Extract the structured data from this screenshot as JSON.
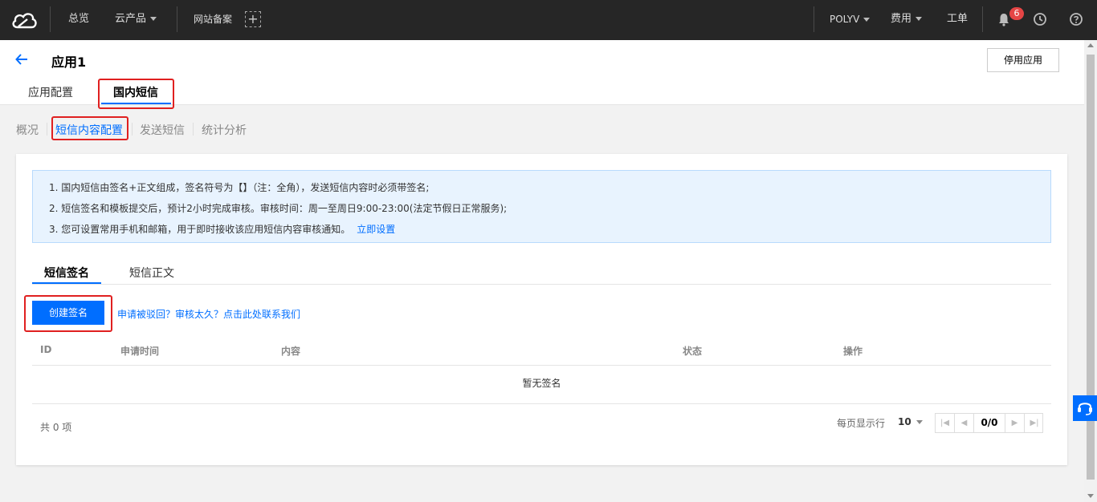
{
  "topnav": {
    "overview": "总览",
    "products": "云产品",
    "icp": "网站备案",
    "plus": "+",
    "account": "POLYV",
    "billing": "费用",
    "ticket": "工单",
    "notification_count": "6"
  },
  "header": {
    "title": "应用1",
    "disable_button": "停用应用",
    "tabs": [
      {
        "label": "应用配置"
      },
      {
        "label": "国内短信"
      }
    ]
  },
  "subnav": {
    "items": [
      {
        "label": "概况"
      },
      {
        "label": "短信内容配置"
      },
      {
        "label": "发送短信"
      },
      {
        "label": "统计分析"
      }
    ]
  },
  "notice": {
    "line1": "1. 国内短信由签名+正文组成，签名符号为【】（注：全角），发送短信内容时必须带签名;",
    "line2": "2. 短信签名和模板提交后，预计2小时完成审核。审核时间：周一至周日9:00-23:00(法定节假日正常服务);",
    "line3": "3. 您可设置常用手机和邮箱，用于即时接收该应用短信内容审核通知。",
    "line3_link": "立即设置"
  },
  "inner_tabs": [
    {
      "label": "短信签名"
    },
    {
      "label": "短信正文"
    }
  ],
  "actions": {
    "create_button": "创建签名",
    "help_link": "申请被驳回？审核太久？点击此处联系我们"
  },
  "table": {
    "columns": [
      "ID",
      "申请时间",
      "内容",
      "状态",
      "操作"
    ],
    "empty_text": "暂无签名"
  },
  "pagination": {
    "total": "共 0 项",
    "per_page_label": "每页显示行",
    "page_size": "10",
    "page_indicator": "0/0"
  },
  "colors": {
    "primary": "#006eff",
    "topnav_bg": "#262626",
    "highlight_red": "#e02020",
    "badge_red": "#e54545"
  }
}
